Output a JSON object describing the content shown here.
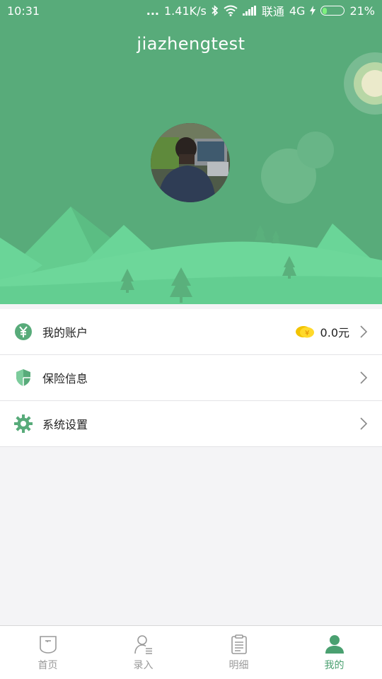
{
  "status_bar": {
    "time": "10:31",
    "dots": "...",
    "speed": "1.41K/s",
    "carrier": "联通",
    "network": "4G",
    "battery": "21%",
    "battery_fraction": 0.21
  },
  "profile": {
    "username": "jiazhengtest"
  },
  "menu": {
    "items": [
      {
        "label": "我的账户",
        "icon": "yuan-icon",
        "balance": "0.0元"
      },
      {
        "label": "保险信息",
        "icon": "shield-icon"
      },
      {
        "label": "系统设置",
        "icon": "gear-icon"
      }
    ]
  },
  "tabbar": {
    "tabs": [
      {
        "label": "首页",
        "icon": "home-icon",
        "active": false
      },
      {
        "label": "录入",
        "icon": "user-entry-icon",
        "active": false
      },
      {
        "label": "明细",
        "icon": "clipboard-icon",
        "active": false
      },
      {
        "label": "我的",
        "icon": "person-icon",
        "active": true
      }
    ]
  },
  "colors": {
    "header_green": "#58ab7a",
    "accent": "#4aa070",
    "hill_light": "#6dd79a",
    "inactive": "#9a9a9a"
  }
}
